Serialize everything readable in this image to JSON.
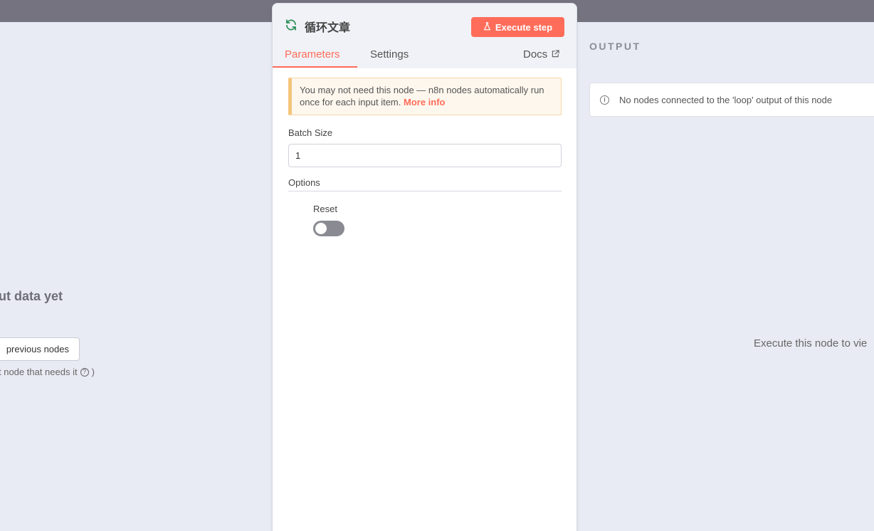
{
  "left_panel": {
    "title": "ut data yet",
    "button_label": "previous nodes",
    "hint": "t node that needs it",
    "hint_icon": "?",
    "hint_suffix": ")"
  },
  "node": {
    "title": "循环文章",
    "execute_label": "Execute step",
    "tabs": {
      "parameters": "Parameters",
      "settings": "Settings",
      "docs": "Docs"
    },
    "notice": {
      "text": "You may not need this node — n8n nodes automatically run once for each input item.",
      "link": "More info"
    },
    "batch_size": {
      "label": "Batch Size",
      "value": "1"
    },
    "options": {
      "label": "Options",
      "reset_label": "Reset",
      "reset_enabled": false
    }
  },
  "output": {
    "label": "OUTPUT",
    "info_icon": "i",
    "message": "No nodes connected to the 'loop' output of this node",
    "execute_hint": "Execute this node to vie"
  },
  "colors": {
    "accent": "#ff6d5a",
    "topbar": "#757380",
    "canvas": "#e8ebf3"
  }
}
